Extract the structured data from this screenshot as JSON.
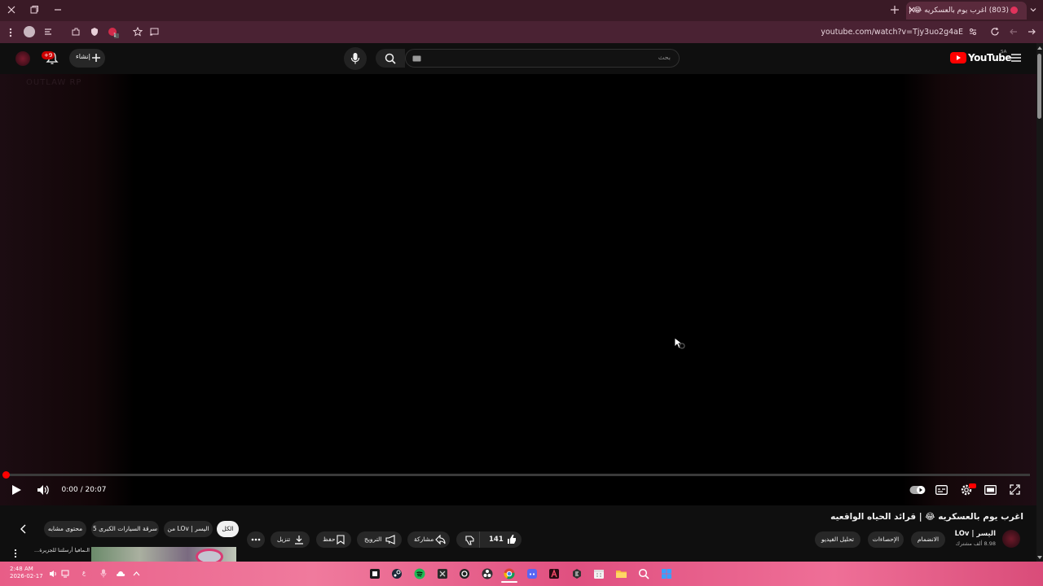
{
  "browser": {
    "tab_title": "(803) اغرب يوم بالعسكريه 😂 | ق...",
    "url": "youtube.com/watch?v=Tjy3uo2g4aE",
    "notification_count": "1",
    "tab_audio_badge": "1"
  },
  "youtube": {
    "logo_text": "YouTube",
    "region": "SA",
    "search_placeholder": "بحث",
    "create_label": "إنشاء",
    "notifications_badge": "+9"
  },
  "player": {
    "watermark": "OUTLAW RP",
    "time_current": "0:00",
    "time_separator": " / ",
    "time_total": "20:07",
    "progress_fraction": 0.004
  },
  "video": {
    "title": "اغرب يوم بالعسكريه 😂 | قرائد الحياه الواقعيه",
    "channel_name": "LOv | اليسر",
    "subscribers": "8.98 ألف مشترك",
    "likes": "141",
    "actions": {
      "join": "الانضمام",
      "stats": "الإحصاءات",
      "analyze": "تحليل الفيديو",
      "share": "مشاركة",
      "promote": "الترويج",
      "save": "حفظ",
      "download": "تنزيل"
    },
    "chips": [
      "الكل",
      "من LOv | اليسر",
      "سرقة السيارات الكبرى 5",
      "محتوى مشابه"
    ]
  },
  "related": {
    "title": "الـمافيا أرسلتنا للجزيرة..."
  },
  "taskbar": {
    "time": "2:48 AM",
    "date": "2026-02-17",
    "lang": "ع"
  },
  "colors": {
    "accent_red": "#ff0000",
    "taskbar_pink": "#ec6790"
  }
}
